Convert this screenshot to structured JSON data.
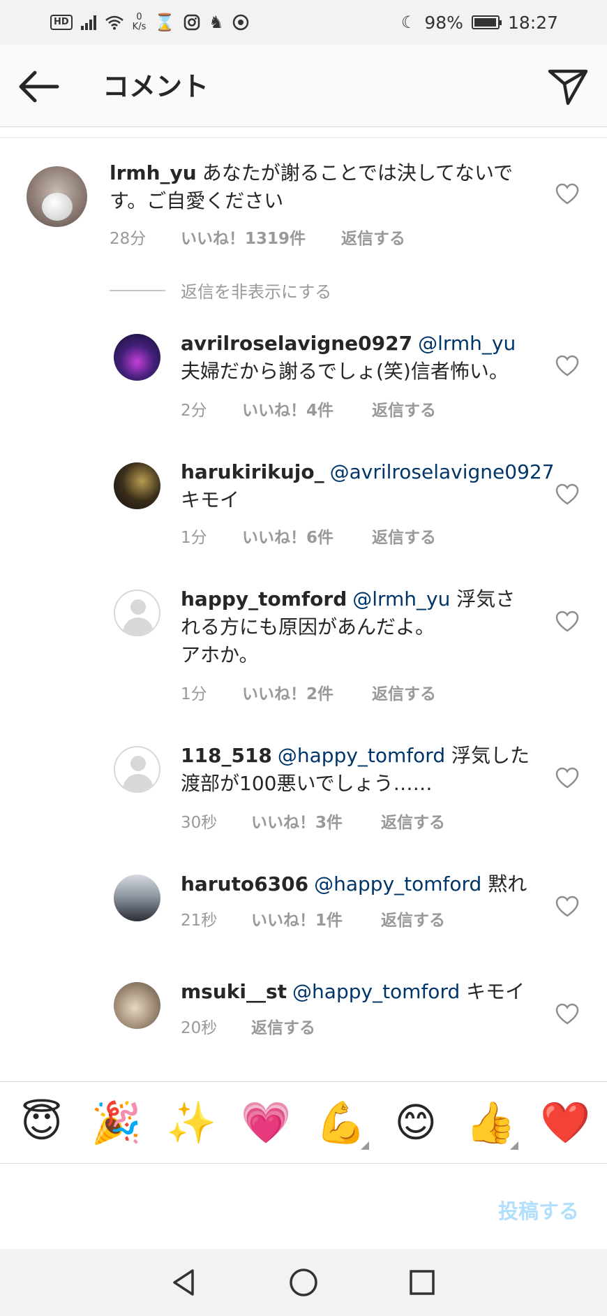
{
  "status_bar": {
    "hd": "HD",
    "speed_value": "0",
    "speed_unit": "K/s",
    "battery": "98%",
    "battery_level": 0.98,
    "time": "18:27"
  },
  "header": {
    "title": "コメント"
  },
  "main_comment": {
    "username": "lrmh_yu",
    "text": "あなたが謝ることでは決してないです。ご自愛ください",
    "time": "28分",
    "likes": "いいね！1319件",
    "reply": "返信する"
  },
  "hide_replies_label": "返信を非表示にする",
  "replies": [
    {
      "username": "avrilroselavigne0927",
      "mention": "@lrmh_yu",
      "text": "夫婦だから謝るでしょ(笑)信者怖い。",
      "time": "2分",
      "likes": "いいね！4件",
      "reply": "返信する"
    },
    {
      "username": "harukirikujo_",
      "mention": "@avrilroselavigne0927",
      "text": "キモイ",
      "time": "1分",
      "likes": "いいね！6件",
      "reply": "返信する"
    },
    {
      "username": "happy_tomford",
      "mention": "@lrmh_yu",
      "text": "浮気される方にも原因があんだよ。",
      "text2": "アホか。",
      "time": "1分",
      "likes": "いいね！2件",
      "reply": "返信する"
    },
    {
      "username": "118_518",
      "mention": "@happy_tomford",
      "text": "浮気した渡部が100悪いでしょう……",
      "time": "30秒",
      "likes": "いいね！3件",
      "reply": "返信する"
    },
    {
      "username": "haruto6306",
      "mention": "@happy_tomford",
      "text": "黙れ",
      "time": "21秒",
      "likes": "いいね！1件",
      "reply": "返信する"
    },
    {
      "username": "msuki__st",
      "mention": "@happy_tomford",
      "text": "キモイ",
      "time": "20秒",
      "reply": "返信する"
    }
  ],
  "emojis": [
    "😇",
    "🎉",
    "✨",
    "💗",
    "💪",
    "😊",
    "👍",
    "❤️"
  ],
  "input": {
    "placeholder": "",
    "post_label": "投稿する"
  },
  "icons": {
    "back": "back-arrow-icon",
    "send": "direct-send-icon",
    "like": "heart-outline-icon"
  }
}
